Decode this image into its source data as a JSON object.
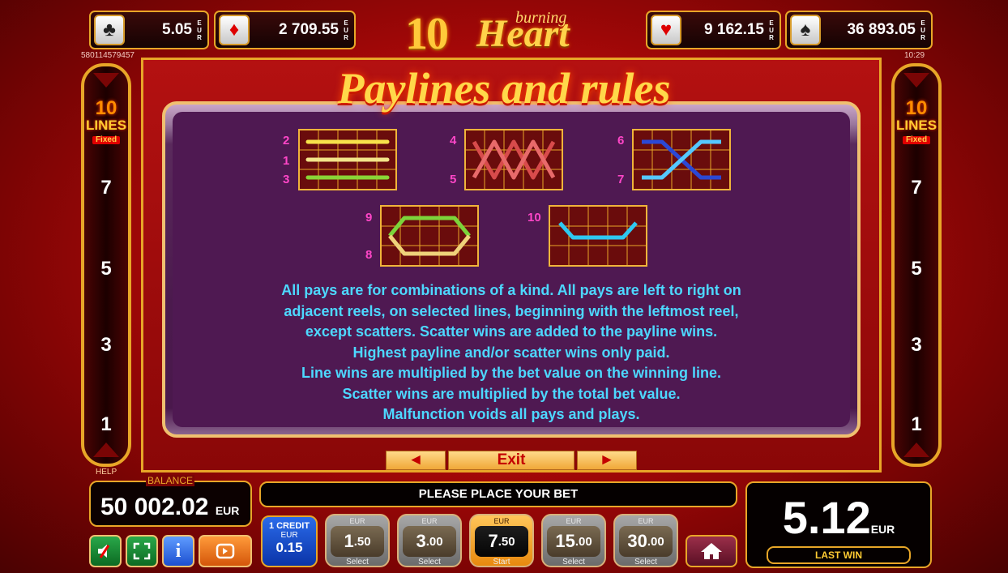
{
  "jackpots": [
    {
      "suit": "clubs",
      "symbol": "♣",
      "value": "5.05",
      "currency": [
        "E",
        "U",
        "R"
      ]
    },
    {
      "suit": "diamonds",
      "symbol": "♦",
      "value": "2 709.55",
      "currency": [
        "E",
        "U",
        "R"
      ]
    },
    {
      "suit": "hearts",
      "symbol": "♥",
      "value": "9 162.15",
      "currency": [
        "E",
        "U",
        "R"
      ]
    },
    {
      "suit": "spades",
      "symbol": "♠",
      "value": "36 893.05",
      "currency": [
        "E",
        "U",
        "R"
      ]
    }
  ],
  "logo": {
    "ten": "10",
    "burning": "burning",
    "heart": "Heart"
  },
  "session_id": "580114579457",
  "clock": "10:29",
  "lines_indicator": {
    "count": "10",
    "label": "LINES",
    "mode": "Fixed",
    "numbers": [
      "7",
      "5",
      "3",
      "1"
    ]
  },
  "title": "Paylines and rules",
  "paylines": {
    "group1": [
      "2",
      "1",
      "3"
    ],
    "group2": [
      "4",
      "5"
    ],
    "group3": [
      "6",
      "7"
    ],
    "group4": [
      "9",
      "8"
    ],
    "group5": [
      "10"
    ]
  },
  "rules": [
    "All pays are for combinations of a kind. All pays are left to right on",
    "adjacent reels, on selected lines, beginning with the leftmost reel,",
    "except scatters. Scatter wins are added to the payline wins.",
    "Highest payline and/or scatter wins only paid.",
    "Line wins are multiplied by the bet value on the winning line.",
    "Scatter wins are multiplied by the total bet value.",
    "Malfunction voids all pays and plays."
  ],
  "nav": {
    "prev": "◄",
    "exit": "Exit",
    "next": "►"
  },
  "help": "HELP",
  "balance": {
    "label": "BALANCE",
    "value": "50 002.02",
    "currency": "EUR"
  },
  "message": "PLEASE PLACE YOUR BET",
  "credit": {
    "label": "1 CREDIT",
    "currency": "EUR",
    "value": "0.15"
  },
  "bets": [
    {
      "currency": "EUR",
      "int": "1",
      "dec": ".50",
      "action": "Select",
      "active": false
    },
    {
      "currency": "EUR",
      "int": "3",
      "dec": ".00",
      "action": "Select",
      "active": false
    },
    {
      "currency": "EUR",
      "int": "7",
      "dec": ".50",
      "action": "Start",
      "active": true
    },
    {
      "currency": "EUR",
      "int": "15",
      "dec": ".00",
      "action": "Select",
      "active": false
    },
    {
      "currency": "EUR",
      "int": "30",
      "dec": ".00",
      "action": "Select",
      "active": false
    }
  ],
  "last_win": {
    "value": "5.12",
    "currency": "EUR",
    "label": "LAST WIN"
  },
  "icons": {
    "sound": "sound-muted-icon",
    "fullscreen": "fullscreen-icon",
    "info": "info-icon",
    "autoplay": "autoplay-icon",
    "home": "home-icon"
  },
  "colors": {
    "accent_gold": "#e8a628",
    "rules_text": "#4dd8ff",
    "panel": "#4f1952",
    "line_numbers": "#ff46c8"
  }
}
